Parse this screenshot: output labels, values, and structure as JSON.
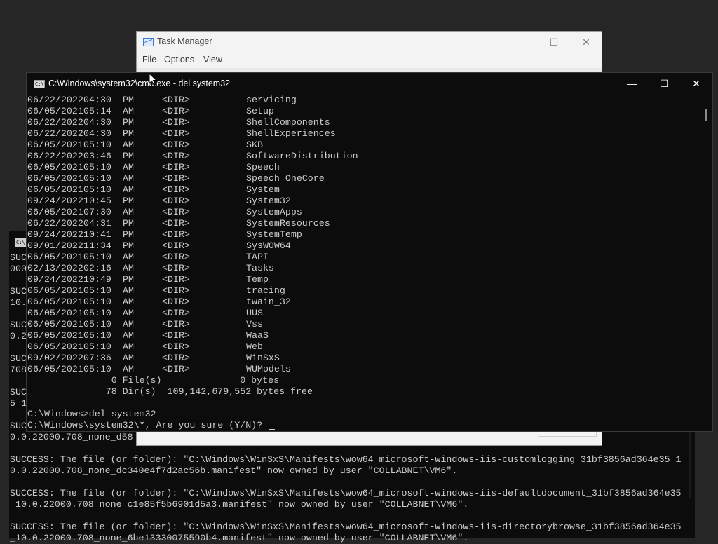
{
  "background_console": {
    "lines": [
      "SUCC",
      "000",
      "",
      "SUC",
      "10.",
      "",
      "SUC",
      "0.2",
      "",
      "SUC",
      "708",
      "",
      "SUC",
      "5_1",
      "",
      "SUC",
      "0.0.22000.708_none_d58",
      "",
      "SUCCESS: The file (or folder): \"C:\\Windows\\WinSxS\\Manifests\\wow64_microsoft-windows-iis-customlogging_31bf3856ad364e35_1",
      "0.0.22000.708_none_dc340e4f7d2ac56b.manifest\" now owned by user \"COLLABNET\\VM6\".",
      "",
      "SUCCESS: The file (or folder): \"C:\\Windows\\WinSxS\\Manifests\\wow64_microsoft-windows-iis-defaultdocument_31bf3856ad364e35",
      "_10.0.22000.708_none_c1e85f5b6901d5a3.manifest\" now owned by user \"COLLABNET\\VM6\".",
      "",
      "SUCCESS: The file (or folder): \"C:\\Windows\\WinSxS\\Manifests\\wow64_microsoft-windows-iis-directorybrowse_31bf3856ad364e35",
      "_10.0.22000.708_none_6be13330075590b4.manifest\" now owned by user \"COLLABNET\\VM6\"."
    ]
  },
  "task_manager": {
    "title": "Task Manager",
    "menu": [
      "File",
      "Options",
      "View"
    ],
    "controls": {
      "minimize": "—",
      "maximize": "☐",
      "close": "✕"
    }
  },
  "console": {
    "title": "C:\\Windows\\system32\\cmd.exe - del  system32",
    "controls": {
      "minimize": "—",
      "maximize": "☐",
      "close": "✕"
    },
    "dir_entries": [
      {
        "date": "06/22/2022",
        "time": "04:30",
        "ampm": "PM",
        "type": "<DIR>",
        "name": "servicing"
      },
      {
        "date": "06/05/2021",
        "time": "05:14",
        "ampm": "AM",
        "type": "<DIR>",
        "name": "Setup"
      },
      {
        "date": "06/22/2022",
        "time": "04:30",
        "ampm": "PM",
        "type": "<DIR>",
        "name": "ShellComponents"
      },
      {
        "date": "06/22/2022",
        "time": "04:30",
        "ampm": "PM",
        "type": "<DIR>",
        "name": "ShellExperiences"
      },
      {
        "date": "06/05/2021",
        "time": "05:10",
        "ampm": "AM",
        "type": "<DIR>",
        "name": "SKB"
      },
      {
        "date": "06/22/2022",
        "time": "03:46",
        "ampm": "PM",
        "type": "<DIR>",
        "name": "SoftwareDistribution"
      },
      {
        "date": "06/05/2021",
        "time": "05:10",
        "ampm": "AM",
        "type": "<DIR>",
        "name": "Speech"
      },
      {
        "date": "06/05/2021",
        "time": "05:10",
        "ampm": "AM",
        "type": "<DIR>",
        "name": "Speech_OneCore"
      },
      {
        "date": "06/05/2021",
        "time": "05:10",
        "ampm": "AM",
        "type": "<DIR>",
        "name": "System"
      },
      {
        "date": "09/24/2022",
        "time": "10:45",
        "ampm": "PM",
        "type": "<DIR>",
        "name": "System32"
      },
      {
        "date": "06/05/2021",
        "time": "07:30",
        "ampm": "AM",
        "type": "<DIR>",
        "name": "SystemApps"
      },
      {
        "date": "06/22/2022",
        "time": "04:31",
        "ampm": "PM",
        "type": "<DIR>",
        "name": "SystemResources"
      },
      {
        "date": "09/24/2022",
        "time": "10:41",
        "ampm": "PM",
        "type": "<DIR>",
        "name": "SystemTemp"
      },
      {
        "date": "09/01/2022",
        "time": "11:34",
        "ampm": "PM",
        "type": "<DIR>",
        "name": "SysWOW64"
      },
      {
        "date": "06/05/2021",
        "time": "05:10",
        "ampm": "AM",
        "type": "<DIR>",
        "name": "TAPI"
      },
      {
        "date": "02/13/2022",
        "time": "02:16",
        "ampm": "AM",
        "type": "<DIR>",
        "name": "Tasks"
      },
      {
        "date": "09/24/2022",
        "time": "10:49",
        "ampm": "PM",
        "type": "<DIR>",
        "name": "Temp"
      },
      {
        "date": "06/05/2021",
        "time": "05:10",
        "ampm": "AM",
        "type": "<DIR>",
        "name": "tracing"
      },
      {
        "date": "06/05/2021",
        "time": "05:10",
        "ampm": "AM",
        "type": "<DIR>",
        "name": "twain_32"
      },
      {
        "date": "06/05/2021",
        "time": "05:10",
        "ampm": "AM",
        "type": "<DIR>",
        "name": "UUS"
      },
      {
        "date": "06/05/2021",
        "time": "05:10",
        "ampm": "AM",
        "type": "<DIR>",
        "name": "Vss"
      },
      {
        "date": "06/05/2021",
        "time": "05:10",
        "ampm": "AM",
        "type": "<DIR>",
        "name": "WaaS"
      },
      {
        "date": "06/05/2021",
        "time": "05:10",
        "ampm": "AM",
        "type": "<DIR>",
        "name": "Web"
      },
      {
        "date": "09/02/2022",
        "time": "07:36",
        "ampm": "AM",
        "type": "<DIR>",
        "name": "WinSxS"
      },
      {
        "date": "06/05/2021",
        "time": "05:10",
        "ampm": "AM",
        "type": "<DIR>",
        "name": "WUModels"
      }
    ],
    "summary_files": "               0 File(s)              0 bytes",
    "summary_dirs": "              78 Dir(s)  109,142,679,552 bytes free",
    "blank": "",
    "command_line": "C:\\Windows>del system32",
    "prompt_line": "C:\\Windows\\system32\\*, Are you sure (Y/N)?"
  }
}
